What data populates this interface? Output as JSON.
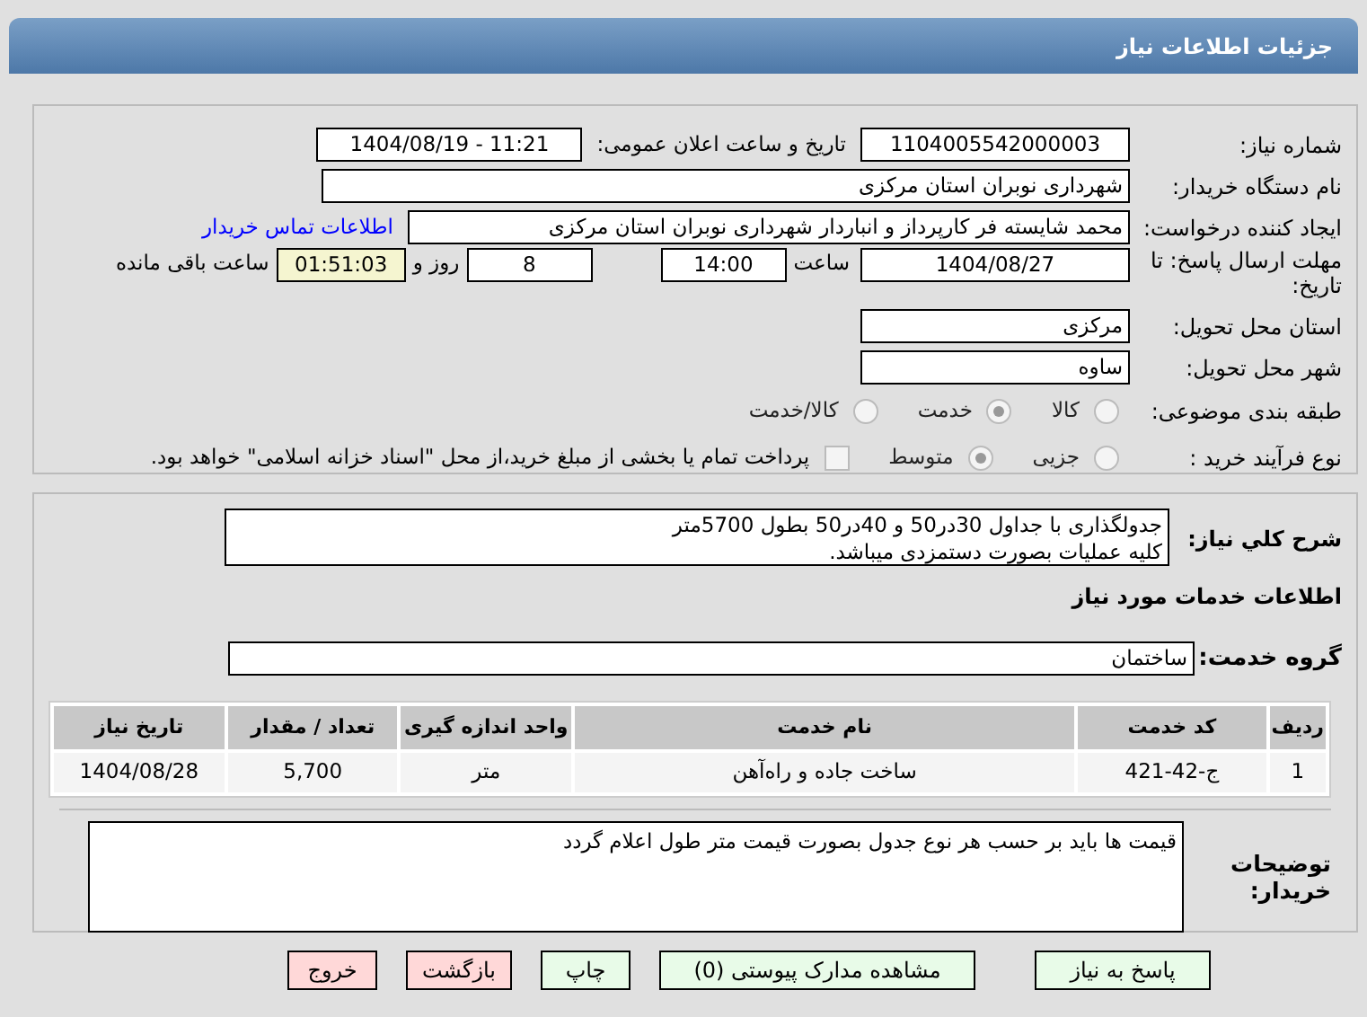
{
  "header": {
    "title": "جزئیات اطلاعات نیاز"
  },
  "need_number": {
    "label": "شماره نیاز:",
    "value": "1104005542000003"
  },
  "announce": {
    "label": "تاریخ و ساعت اعلان عمومی:",
    "value": "1404/08/19 - 11:21"
  },
  "buyer_org": {
    "label": "نام دستگاه خریدار:",
    "value": "شهرداری نوبران استان مرکزی"
  },
  "requester": {
    "label": "ایجاد کننده درخواست:",
    "value": "محمد شایسته فر کارپرداز و انباردار شهرداری نوبران استان مرکزی",
    "link": "اطلاعات تماس خریدار"
  },
  "deadline": {
    "label": "مهلت ارسال پاسخ: تا تاریخ:",
    "date": "1404/08/27",
    "time_label": "ساعت",
    "time": "14:00",
    "days": "8",
    "days_label": "روز و",
    "remaining": "01:51:03",
    "remaining_label": "ساعت باقی مانده"
  },
  "province": {
    "label": "استان محل تحویل:",
    "value": "مرکزی"
  },
  "city": {
    "label": "شهر محل تحویل:",
    "value": "ساوه"
  },
  "category": {
    "label": "طبقه بندی موضوعی:",
    "options": [
      {
        "label": "کالا",
        "selected": false
      },
      {
        "label": "خدمت",
        "selected": true
      },
      {
        "label": "کالا/خدمت",
        "selected": false
      }
    ]
  },
  "process": {
    "label": "نوع فرآیند خرید :",
    "options": [
      {
        "label": "جزیی",
        "selected": false
      },
      {
        "label": "متوسط",
        "selected": true
      }
    ],
    "payment": {
      "checked": false,
      "text": "پرداخت تمام یا بخشی از مبلغ خرید،از محل \"اسناد خزانه اسلامی\" خواهد بود."
    }
  },
  "description": {
    "label": "شرح کلي نياز:",
    "lines": [
      "جدولگذاری با جداول 30در50 و 40در50 بطول 5700متر",
      "کلیه عملیات بصورت دستمزدی میباشد."
    ]
  },
  "services_title": "اطلاعات خدمات مورد نیاز",
  "service_group": {
    "label": "گروه خدمت:",
    "value": "ساختمان"
  },
  "table": {
    "columns": [
      "ردیف",
      "کد خدمت",
      "نام خدمت",
      "واحد اندازه گیری",
      "تعداد / مقدار",
      "تاریخ نیاز"
    ],
    "rows": [
      [
        "1",
        "ج-42-421",
        "ساخت جاده و راه‌آهن",
        "متر",
        "5,700",
        "1404/08/28"
      ]
    ]
  },
  "buyer_notes": {
    "label": "توضیحات خریدار:",
    "value": "قیمت ها باید بر حسب هر نوع جدول بصورت قیمت متر طول اعلام گردد"
  },
  "buttons": [
    {
      "label": "پاسخ به نیاز",
      "kind": "green"
    },
    {
      "label": "مشاهده مدارک پیوستی (0)",
      "kind": "green"
    },
    {
      "label": "چاپ",
      "kind": "green"
    },
    {
      "label": "بازگشت",
      "kind": "red"
    },
    {
      "label": "خروج",
      "kind": "red"
    }
  ]
}
